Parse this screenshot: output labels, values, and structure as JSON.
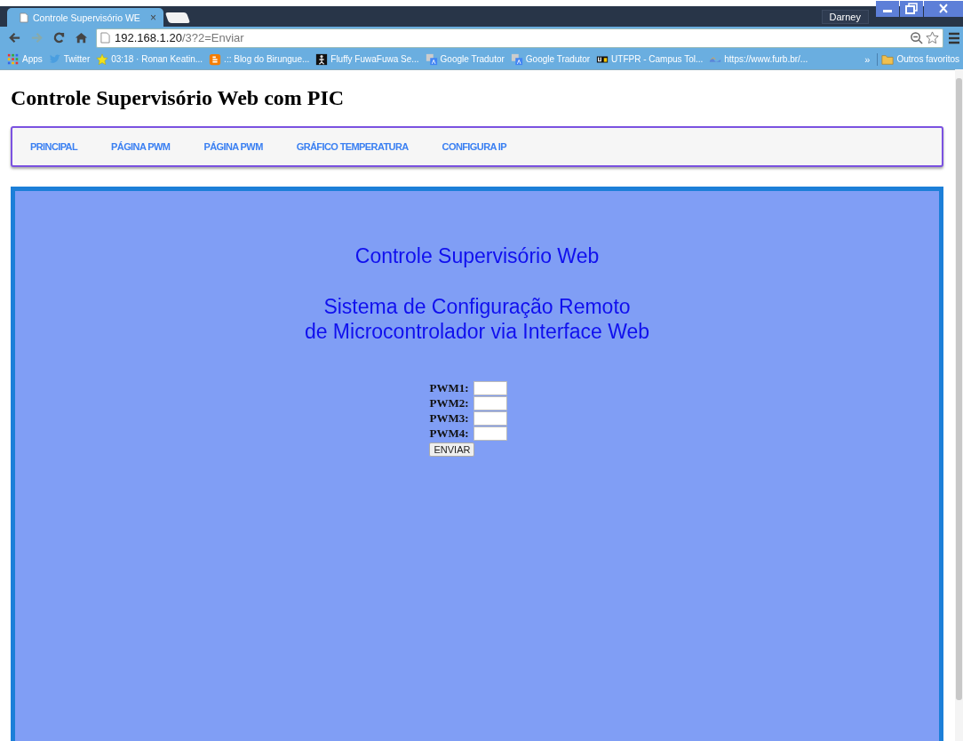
{
  "browser": {
    "tabs": [
      {
        "title": "Controle Supervisório WE",
        "close": "×",
        "selected": true
      }
    ],
    "user": "Darney",
    "address": {
      "host": "192.168.1.20",
      "path": "/3?2=Enviar"
    },
    "bookmarks": [
      {
        "kind": "apps",
        "label": "Apps"
      },
      {
        "kind": "bird",
        "label": "Twitter"
      },
      {
        "kind": "star",
        "label": "03:18 · Ronan Keatin..."
      },
      {
        "kind": "blogger",
        "label": ".:: Blog do Birungue..."
      },
      {
        "kind": "figure",
        "label": "Fluffy FuwaFuwa Se..."
      },
      {
        "kind": "translate",
        "label": "Google Tradutor"
      },
      {
        "kind": "translate",
        "label": "Google Tradutor"
      },
      {
        "kind": "utf",
        "label": "UTFPR - Campus Tol..."
      },
      {
        "kind": "wave",
        "label": "https://www.furb.br/..."
      }
    ],
    "overflow": "»",
    "other_bookmarks": "Outros favoritos"
  },
  "page": {
    "title": "Controle Supervisório Web com PIC",
    "nav": [
      "PRINCIPAL",
      "PÁGINA PWM",
      "PÁGINA PWM",
      "GRÁFICO TEMPERATURA",
      "CONFIGURA IP"
    ],
    "panel": {
      "heading": "Controle Supervisório Web",
      "subheading_lines": [
        "Sistema de Configuração Remoto",
        "de Microcontrolador via Interface Web"
      ],
      "fields": [
        {
          "label": "PWM1:"
        },
        {
          "label": "PWM2:"
        },
        {
          "label": "PWM3:"
        },
        {
          "label": "PWM4:"
        }
      ],
      "submit": "ENVIAR"
    }
  }
}
